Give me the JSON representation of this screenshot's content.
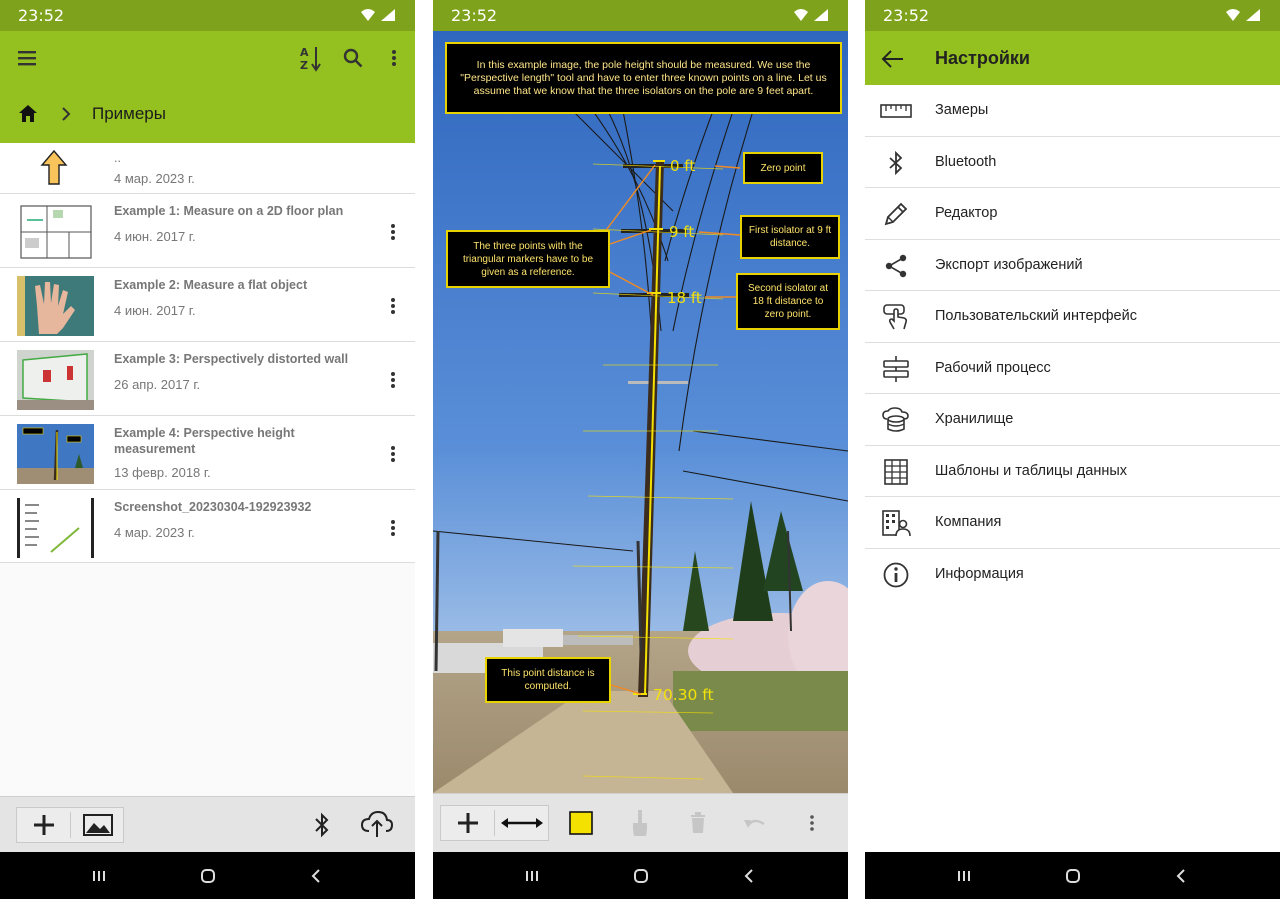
{
  "status": {
    "time": "23:52"
  },
  "files_screen": {
    "breadcrumb": {
      "folder": "Примеры"
    },
    "items": [
      {
        "name": "..",
        "date": "4 мар. 2023 г."
      },
      {
        "name": "Example 1: Measure on a 2D floor plan",
        "date": "4 июн. 2017 г."
      },
      {
        "name": "Example 2: Measure a flat object",
        "date": "4 июн. 2017 г."
      },
      {
        "name": "Example 3: Perspectively distorted wall",
        "date": "26 апр. 2017 г."
      },
      {
        "name": "Example 4: Perspective height measurement",
        "date": "13 февр. 2018 г."
      },
      {
        "name": "Screenshot_20230304-192923932",
        "date": "4 мар. 2023 г."
      }
    ]
  },
  "measure_screen": {
    "notes": {
      "intro": "In this example image, the pole height should be measured. We use the \"Perspective length\" tool and have to enter three known points on a line. Let us assume that we know that the three isolators on the pole are 9 feet apart.",
      "zero": "Zero point",
      "first": "First isolator at 9 ft distance.",
      "second": "Second isolator at 18 ft distance to zero point.",
      "markers": "The three points with the triangular markers have to be given as a reference.",
      "computed": "This point distance is computed."
    },
    "labels": {
      "zero": "0 ft",
      "nine": "9 ft",
      "eighteen": "18 ft",
      "result": "70.30 ft"
    },
    "selected_color": "#f5e100"
  },
  "settings_screen": {
    "title": "Настройки",
    "items": [
      {
        "icon": "ruler-icon",
        "label": "Замеры"
      },
      {
        "icon": "bluetooth-icon",
        "label": "Bluetooth"
      },
      {
        "icon": "pencil-icon",
        "label": "Редактор"
      },
      {
        "icon": "share-icon",
        "label": "Экспорт изображений"
      },
      {
        "icon": "touch-icon",
        "label": "Пользовательский интерфейс"
      },
      {
        "icon": "workflow-icon",
        "label": "Рабочий процесс"
      },
      {
        "icon": "storage-icon",
        "label": "Хранилище"
      },
      {
        "icon": "table-icon",
        "label": "Шаблоны и таблицы данных"
      },
      {
        "icon": "company-icon",
        "label": "Компания"
      },
      {
        "icon": "info-icon",
        "label": "Информация"
      }
    ]
  },
  "colors": {
    "status_bar": "#7fa21c",
    "app_bar": "#94c11f",
    "accent_yellow": "#f5e100"
  }
}
